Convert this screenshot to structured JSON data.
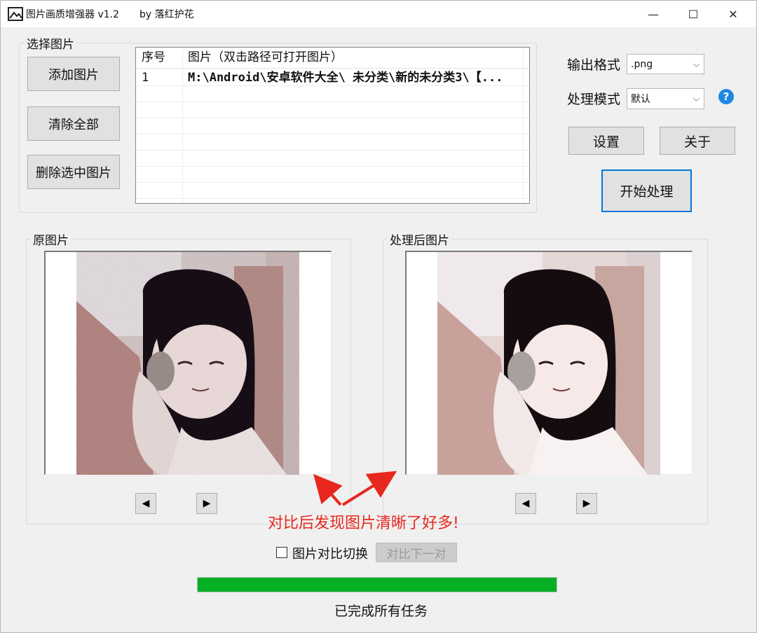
{
  "window": {
    "title": "图片画质增强器 v1.2",
    "author": "by 落红护花",
    "minimize_glyph": "—",
    "maximize_glyph": "☐",
    "close_glyph": "✕",
    "icon": "image-icon"
  },
  "select_group": {
    "label": "选择图片",
    "buttons": {
      "add": "添加图片",
      "clear": "清除全部",
      "delete": "删除选中图片"
    },
    "table": {
      "columns": [
        "序号",
        "图片（双击路径可打开图片）"
      ],
      "rows": [
        {
          "index": "1",
          "path": "M:\\Android\\安卓软件大全\\ 未分类\\新的未分类3\\【..."
        }
      ]
    }
  },
  "settings": {
    "output_format_label": "输出格式",
    "output_format_value": ".png",
    "mode_label": "处理模式",
    "mode_value": "默认",
    "help_glyph": "?",
    "settings_button": "设置",
    "about_button": "关于",
    "start_button": "开始处理"
  },
  "original_group": {
    "label": "原图片",
    "prev_glyph": "◀",
    "next_glyph": "▶"
  },
  "processed_group": {
    "label": "处理后图片",
    "prev_glyph": "◀",
    "next_glyph": "▶"
  },
  "annotation": {
    "text": "对比后发现图片清晰了好多!",
    "color": "#e8281e"
  },
  "compare": {
    "checkbox_label": "图片对比切换",
    "next_pair_button": "对比下一对"
  },
  "progress": {
    "value_percent": 100,
    "color": "#06b025"
  },
  "status_text": "已完成所有任务"
}
